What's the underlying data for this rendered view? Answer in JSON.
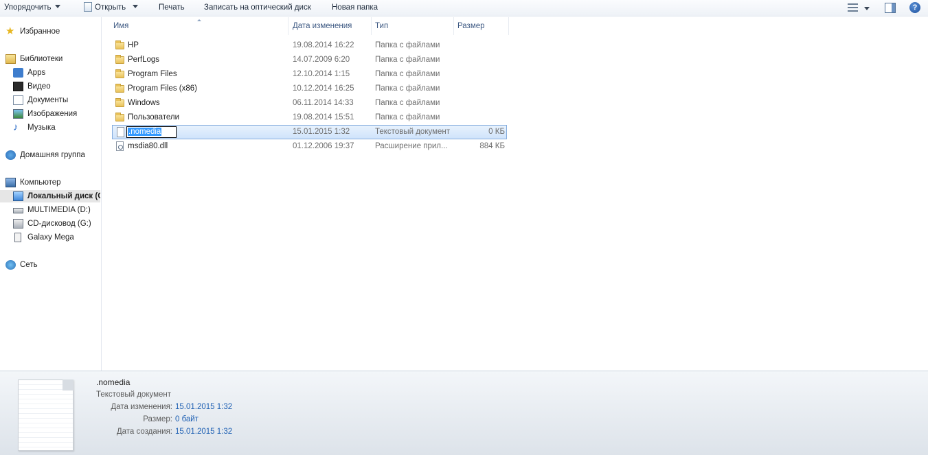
{
  "toolbar": {
    "organize": "Упорядочить",
    "open": "Открыть",
    "print": "Печать",
    "burn": "Записать на оптический диск",
    "new_folder": "Новая папка",
    "help": "?"
  },
  "nav": {
    "favorites": "Избранное",
    "libraries": "Библиотеки",
    "apps": "Apps",
    "video": "Видео",
    "documents": "Документы",
    "images": "Изображения",
    "music": "Музыка",
    "homegroup": "Домашняя группа",
    "computer": "Компьютер",
    "local_disk": "Локальный диск (C",
    "multimedia": "MULTIMEDIA (D:)",
    "cd_drive": "CD-дисковод (G:)",
    "galaxy": "Galaxy Mega",
    "network": "Сеть"
  },
  "columns": {
    "name": "Имя",
    "date": "Дата изменения",
    "type": "Тип",
    "size": "Размер"
  },
  "files": [
    {
      "name": "HP",
      "date": "19.08.2014 16:22",
      "type": "Папка с файлами",
      "size": "",
      "icon": "folder-icon"
    },
    {
      "name": "PerfLogs",
      "date": "14.07.2009 6:20",
      "type": "Папка с файлами",
      "size": "",
      "icon": "folder-icon"
    },
    {
      "name": "Program Files",
      "date": "12.10.2014 1:15",
      "type": "Папка с файлами",
      "size": "",
      "icon": "folder-icon"
    },
    {
      "name": "Program Files (x86)",
      "date": "10.12.2014 16:25",
      "type": "Папка с файлами",
      "size": "",
      "icon": "folder-icon"
    },
    {
      "name": "Windows",
      "date": "06.11.2014 14:33",
      "type": "Папка с файлами",
      "size": "",
      "icon": "folder-icon"
    },
    {
      "name": "Пользователи",
      "date": "19.08.2014 15:51",
      "type": "Папка с файлами",
      "size": "",
      "icon": "folder-icon"
    },
    {
      "name": ".nomedia",
      "date": "15.01.2015 1:32",
      "type": "Текстовый документ",
      "size": "0 КБ",
      "icon": "text-document-icon"
    },
    {
      "name": "msdia80.dll",
      "date": "01.12.2006 19:37",
      "type": "Расширение прил...",
      "size": "884 КБ",
      "icon": "dll-file-icon"
    }
  ],
  "details": {
    "name": ".nomedia",
    "type": "Текстовый документ",
    "modified_label": "Дата изменения:",
    "modified_value": "15.01.2015 1:32",
    "size_label": "Размер:",
    "size_value": "0 байт",
    "created_label": "Дата создания:",
    "created_value": "15.01.2015 1:32"
  }
}
